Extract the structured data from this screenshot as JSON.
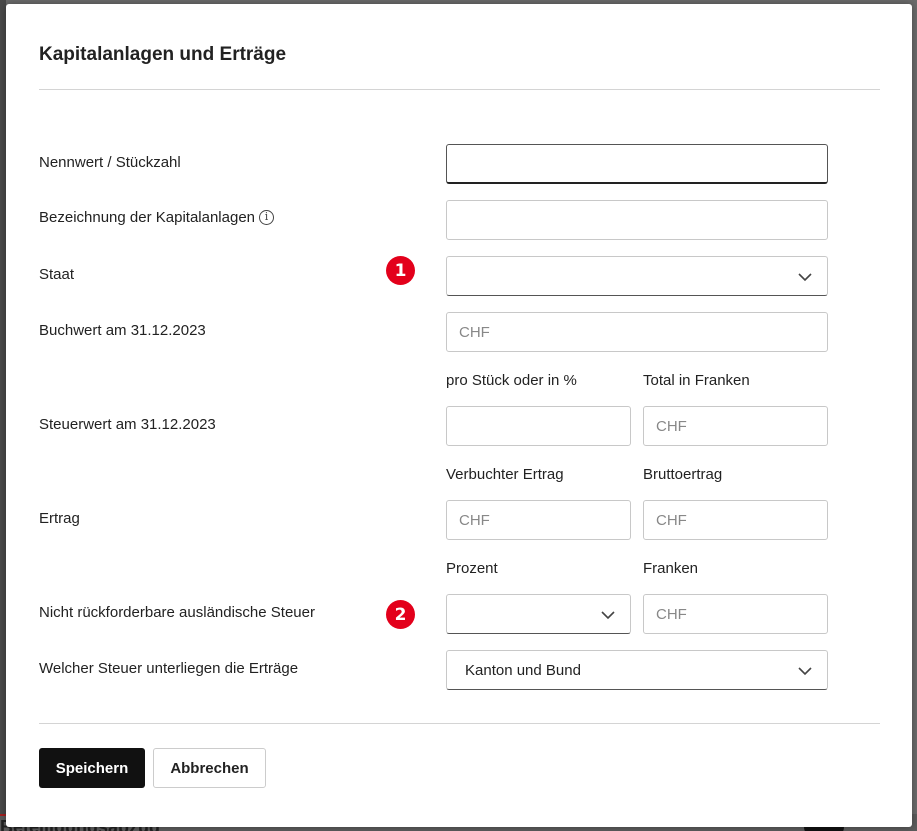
{
  "background": {
    "bottom_text": "Beteiligungsabzug"
  },
  "modal": {
    "title": "Kapitalanlagen und Erträge",
    "rows": {
      "nennwert": {
        "label": "Nennwert / Stückzahl",
        "value": ""
      },
      "bezeichnung": {
        "label": "Bezeichnung der Kapitalanlagen",
        "value": ""
      },
      "staat": {
        "label": "Staat",
        "value": "",
        "badge": "1"
      },
      "buchwert": {
        "label": "Buchwert am 31.12.2023",
        "placeholder": "CHF"
      },
      "steuerwert": {
        "label": "Steuerwert am 31.12.2023",
        "col1_label": "pro Stück oder in %",
        "col2_label": "Total in Franken",
        "col1_value": "",
        "col2_placeholder": "CHF"
      },
      "ertrag": {
        "label": "Ertrag",
        "col1_label": "Verbuchter Ertrag",
        "col2_label": "Bruttoertrag",
        "col1_placeholder": "CHF",
        "col2_placeholder": "CHF"
      },
      "steuer": {
        "label": "Nicht rückforderbare ausländische Steuer",
        "col1_label": "Prozent",
        "col2_label": "Franken",
        "col1_value": "",
        "col2_placeholder": "CHF",
        "badge": "2"
      },
      "unterliegen": {
        "label": "Welcher Steuer unterliegen die Erträge",
        "value": "Kanton und Bund"
      }
    },
    "buttons": {
      "save": "Speichern",
      "cancel": "Abbrechen"
    }
  },
  "colors": {
    "badge": "#e3001b",
    "primary_button": "#111111"
  }
}
